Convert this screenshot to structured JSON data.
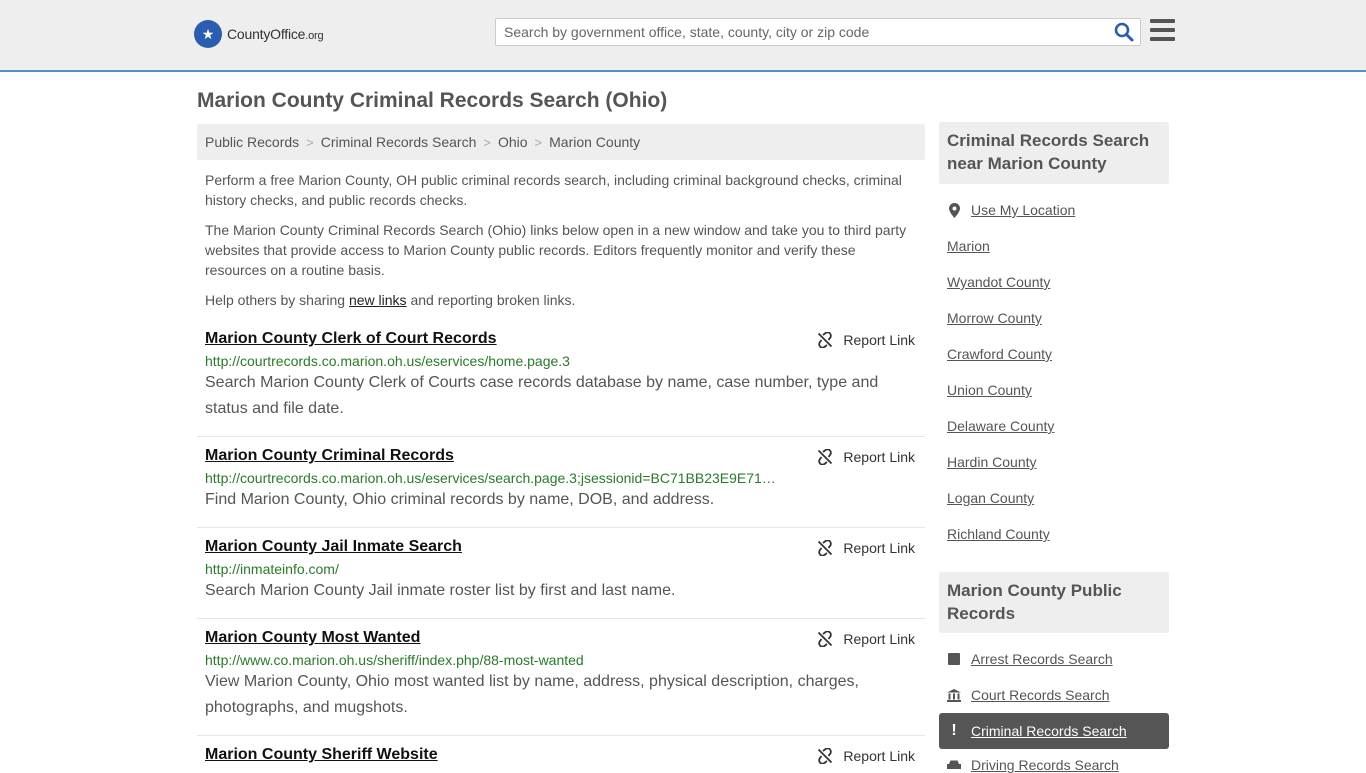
{
  "header": {
    "logo_text": "CountyOffice",
    "logo_suffix": ".org",
    "search_placeholder": "Search by government office, state, county, city or zip code"
  },
  "page_title": "Marion County Criminal Records Search (Ohio)",
  "breadcrumb": [
    "Public Records",
    "Criminal Records Search",
    "Ohio",
    "Marion County"
  ],
  "intro": {
    "p1": "Perform a free Marion County, OH public criminal records search, including criminal background checks, criminal history checks, and public records checks.",
    "p2": "The Marion County Criminal Records Search (Ohio) links below open in a new window and take you to third party websites that provide access to Marion County public records. Editors frequently monitor and verify these resources on a routine basis.",
    "p3_before": "Help others by sharing ",
    "p3_link": "new links",
    "p3_after": " and reporting broken links."
  },
  "report_label": "Report Link",
  "listings": [
    {
      "title": "Marion County Clerk of Court Records",
      "url": "http://courtrecords.co.marion.oh.us/eservices/home.page.3",
      "desc": "Search Marion County Clerk of Courts case records database by name, case number, type and status and file date."
    },
    {
      "title": "Marion County Criminal Records",
      "url": "http://courtrecords.co.marion.oh.us/eservices/search.page.3;jsessionid=BC71BB23E9E71…",
      "desc": "Find Marion County, Ohio criminal records by name, DOB, and address."
    },
    {
      "title": "Marion County Jail Inmate Search",
      "url": "http://inmateinfo.com/",
      "desc": "Search Marion County Jail inmate roster list by first and last name."
    },
    {
      "title": "Marion County Most Wanted",
      "url": "http://www.co.marion.oh.us/sheriff/index.php/88-most-wanted",
      "desc": "View Marion County, Ohio most wanted list by name, address, physical description, charges, photographs, and mugshots."
    },
    {
      "title": "Marion County Sheriff Website",
      "url": "",
      "desc": ""
    }
  ],
  "sidebar": {
    "nearby_heading": "Criminal Records Search near Marion County",
    "use_location": "Use My Location",
    "nearby": [
      "Marion",
      "Wyandot County",
      "Morrow County",
      "Crawford County",
      "Union County",
      "Delaware County",
      "Hardin County",
      "Logan County",
      "Richland County"
    ],
    "public_heading": "Marion County Public Records",
    "public_links": [
      "Arrest Records Search",
      "Court Records Search",
      "Criminal Records Search",
      "Driving Records Search"
    ]
  }
}
